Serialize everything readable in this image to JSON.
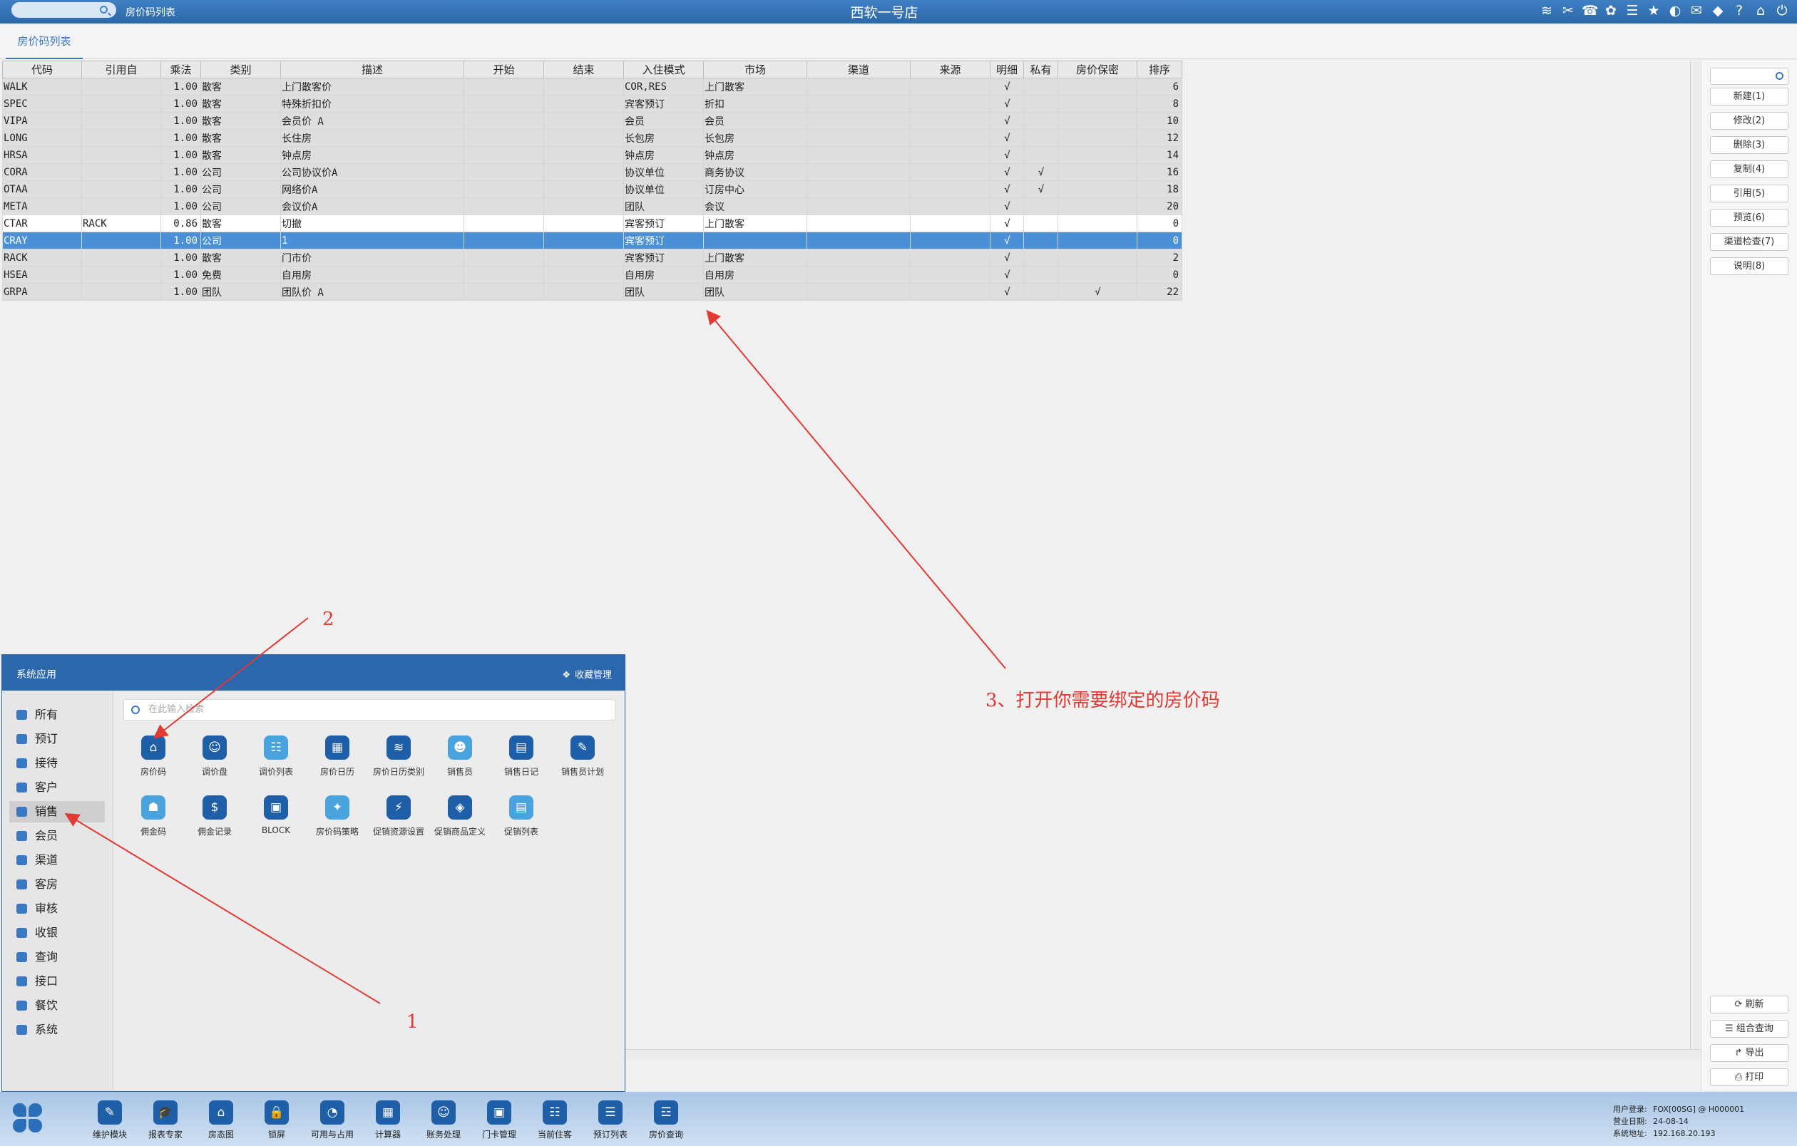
{
  "header": {
    "breadcrumb": "房价码列表",
    "hotel": "西软一号店"
  },
  "tab": {
    "label": "房价码列表"
  },
  "columns": [
    "代码",
    "引用自",
    "乘法",
    "类别",
    "描述",
    "开始",
    "结束",
    "入住模式",
    "市场",
    "渠道",
    "来源",
    "明细",
    "私有",
    "房价保密",
    "排序"
  ],
  "rows": [
    {
      "code": "WALK",
      "ref": "",
      "mult": "1.00",
      "cat": "散客",
      "desc": "上门散客价",
      "start": "",
      "end": "",
      "mode": "COR,RES",
      "market": "上门散客",
      "channel": "",
      "source": "",
      "detail": "√",
      "private": "",
      "secret": "",
      "order": "6",
      "style": "normal"
    },
    {
      "code": "SPEC",
      "ref": "",
      "mult": "1.00",
      "cat": "散客",
      "desc": "特殊折扣价",
      "start": "",
      "end": "",
      "mode": "宾客预订",
      "market": "折扣",
      "channel": "",
      "source": "",
      "detail": "√",
      "private": "",
      "secret": "",
      "order": "8",
      "style": "normal"
    },
    {
      "code": "VIPA",
      "ref": "",
      "mult": "1.00",
      "cat": "散客",
      "desc": "会员价 A",
      "start": "",
      "end": "",
      "mode": "会员",
      "market": "会员",
      "channel": "",
      "source": "",
      "detail": "√",
      "private": "",
      "secret": "",
      "order": "10",
      "style": "normal"
    },
    {
      "code": "LONG",
      "ref": "",
      "mult": "1.00",
      "cat": "散客",
      "desc": "长住房",
      "start": "",
      "end": "",
      "mode": "长包房",
      "market": "长包房",
      "channel": "",
      "source": "",
      "detail": "√",
      "private": "",
      "secret": "",
      "order": "12",
      "style": "normal"
    },
    {
      "code": "HRSA",
      "ref": "",
      "mult": "1.00",
      "cat": "散客",
      "desc": "钟点房",
      "start": "",
      "end": "",
      "mode": "钟点房",
      "market": "钟点房",
      "channel": "",
      "source": "",
      "detail": "√",
      "private": "",
      "secret": "",
      "order": "14",
      "style": "normal"
    },
    {
      "code": "CORA",
      "ref": "",
      "mult": "1.00",
      "cat": "公司",
      "desc": "公司协议价A",
      "start": "",
      "end": "",
      "mode": "协议单位",
      "market": "商务协议",
      "channel": "",
      "source": "",
      "detail": "√",
      "private": "√",
      "secret": "",
      "order": "16",
      "style": "normal"
    },
    {
      "code": "OTAA",
      "ref": "",
      "mult": "1.00",
      "cat": "公司",
      "desc": "网络价A",
      "start": "",
      "end": "",
      "mode": "协议单位",
      "market": "订房中心",
      "channel": "",
      "source": "",
      "detail": "√",
      "private": "√",
      "secret": "",
      "order": "18",
      "style": "normal"
    },
    {
      "code": "META",
      "ref": "",
      "mult": "1.00",
      "cat": "公司",
      "desc": "会议价A",
      "start": "",
      "end": "",
      "mode": "团队",
      "market": "会议",
      "channel": "",
      "source": "",
      "detail": "√",
      "private": "",
      "secret": "",
      "order": "20",
      "style": "normal"
    },
    {
      "code": "CTAR",
      "ref": "RACK",
      "mult": "0.86",
      "cat": "散客",
      "desc": "切撤",
      "start": "",
      "end": "",
      "mode": "宾客预订",
      "market": "上门散客",
      "channel": "",
      "source": "",
      "detail": "√",
      "private": "",
      "secret": "",
      "order": "0",
      "style": "white"
    },
    {
      "code": "CRAY",
      "ref": "",
      "mult": "1.00",
      "cat": "公司",
      "desc": "1",
      "start": "",
      "end": "",
      "mode": "宾客预订",
      "market": "",
      "channel": "",
      "source": "",
      "detail": "√",
      "private": "",
      "secret": "",
      "order": "0",
      "style": "selected"
    },
    {
      "code": "RACK",
      "ref": "",
      "mult": "1.00",
      "cat": "散客",
      "desc": "门市价",
      "start": "",
      "end": "",
      "mode": "宾客预订",
      "market": "上门散客",
      "channel": "",
      "source": "",
      "detail": "√",
      "private": "",
      "secret": "",
      "order": "2",
      "style": "normal"
    },
    {
      "code": "HSEA",
      "ref": "",
      "mult": "1.00",
      "cat": "免费",
      "desc": "自用房",
      "start": "",
      "end": "",
      "mode": "自用房",
      "market": "自用房",
      "channel": "",
      "source": "",
      "detail": "√",
      "private": "",
      "secret": "",
      "order": "0",
      "style": "normal"
    },
    {
      "code": "GRPA",
      "ref": "",
      "mult": "1.00",
      "cat": "团队",
      "desc": "团队价 A",
      "start": "",
      "end": "",
      "mode": "团队",
      "market": "团队",
      "channel": "",
      "source": "",
      "detail": "√",
      "private": "",
      "secret": "√",
      "order": "22",
      "style": "normal"
    }
  ],
  "right_panel": {
    "buttons": [
      "新建(1)",
      "修改(2)",
      "删除(3)",
      "复制(4)",
      "引用(5)",
      "预览(6)",
      "渠道检查(7)",
      "说明(8)"
    ],
    "bottom_buttons": [
      "⟳ 刷新",
      "☰ 组合查询",
      "↱ 导出",
      "⎙ 打印"
    ]
  },
  "popup": {
    "title": "系统应用",
    "fav": "收藏管理",
    "search_placeholder": "在此输入检索",
    "nav": [
      "所有",
      "预订",
      "接待",
      "客户",
      "销售",
      "会员",
      "渠道",
      "客房",
      "审核",
      "收银",
      "查询",
      "接口",
      "餐饮",
      "系统"
    ],
    "active_nav": "销售",
    "apps": [
      "房价码",
      "调价盘",
      "调价列表",
      "房价日历",
      "房价日历类别",
      "销售员",
      "销售日记",
      "销售员计划",
      "佣金码",
      "佣金记录",
      "BLOCK",
      "房价码策略",
      "促销资源设置",
      "促销商品定义",
      "促销列表"
    ]
  },
  "bottombar": {
    "apps": [
      "维护模块",
      "报表专家",
      "房态图",
      "锁屏",
      "可用与占用",
      "计算器",
      "账务处理",
      "门卡管理",
      "当前住客",
      "预订列表",
      "房价查询"
    ],
    "info": [
      {
        "label": "用户登录:",
        "value": "FOX[00SG] @ H000001"
      },
      {
        "label": "营业日期:",
        "value": "24-08-14"
      },
      {
        "label": "系统地址:",
        "value": "192.168.20.193"
      }
    ]
  },
  "annotations": {
    "n1": "1",
    "n2": "2",
    "n3": "3、打开你需要绑定的房价码"
  },
  "colors": {
    "brand": "#2b67aa",
    "selected_row": "#4a90d9",
    "annotation": "#e23a32"
  }
}
